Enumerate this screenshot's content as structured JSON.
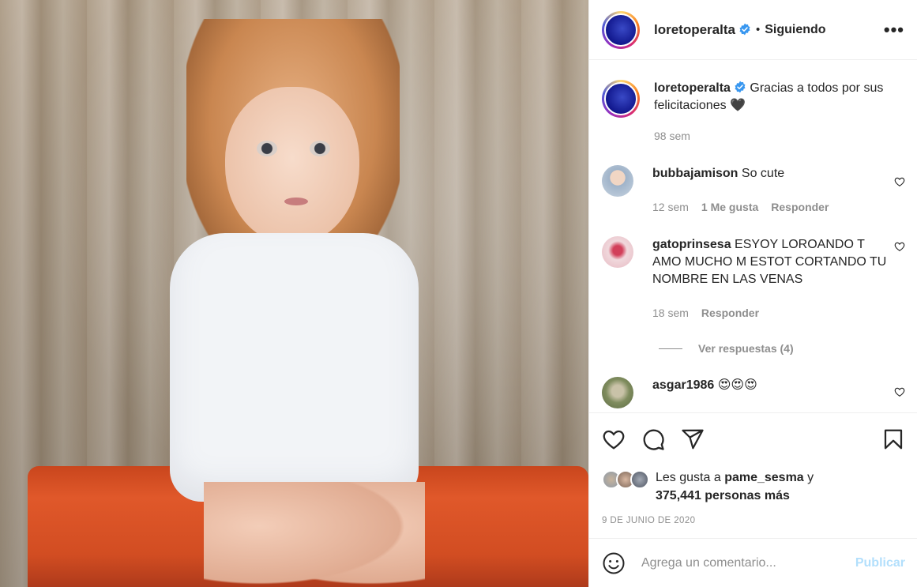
{
  "post": {
    "username": "loretoperalta",
    "separator": "•",
    "follow_status": "Siguiendo",
    "more_label": "•••",
    "caption": {
      "username": "loretoperalta",
      "text": "Gracias a todos por sus felicitaciones",
      "emoji": "🖤",
      "time": "98 sem"
    }
  },
  "comments": [
    {
      "username": "bubbajamison",
      "text": "So cute",
      "time": "12 sem",
      "likes": "1 Me gusta",
      "reply": "Responder",
      "avatar_color": "#b9c6d6"
    },
    {
      "username": "gatoprinsesa",
      "text": "ESYOY LOROANDO T AMO MUCHO M ESTOT CORTANDO TU NOMBRE EN LAS VENAS",
      "time": "18 sem",
      "reply": "Responder",
      "view_replies": "Ver respuestas (4)",
      "avatar_color": "#e7b9c2"
    },
    {
      "username": "asgar1986",
      "text": "😍😍😍",
      "avatar_color": "#8f9a6a"
    }
  ],
  "actions": {
    "icons": [
      "heart-icon",
      "comment-icon",
      "share-icon",
      "bookmark-icon"
    ],
    "likes_prefix": "Les gusta a",
    "liked_by": "pame_sesma",
    "likes_joiner": "y",
    "likes_count": "375,441 personas más",
    "date": "9 DE JUNIO DE 2020"
  },
  "composer": {
    "placeholder": "Agrega un comentario...",
    "publish_label": "Publicar"
  },
  "colors": {
    "accent_blue": "#0095f6",
    "publish_disabled": "#b2dffc",
    "verified": "#3897f0",
    "muted_text": "#8e8e8e",
    "text": "#262626"
  }
}
